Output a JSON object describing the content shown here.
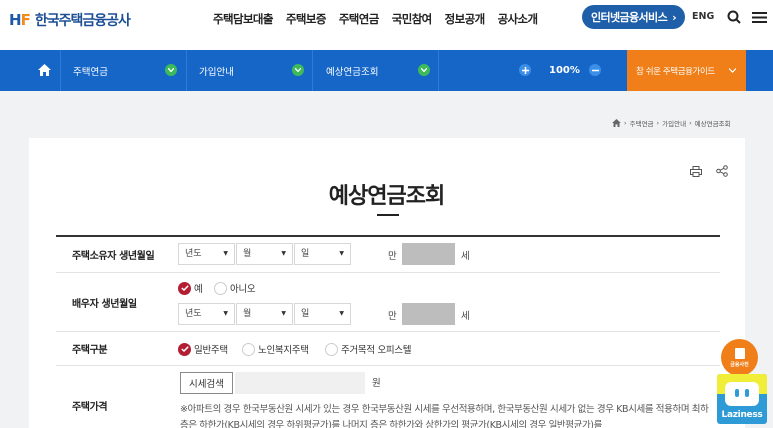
{
  "header": {
    "logo_mark_1": "H",
    "logo_mark_2": "F",
    "logo_text": "한국주택금융공사",
    "gnb": [
      "주택담보대출",
      "주택보증",
      "주택연금",
      "국민참여",
      "정보공개",
      "공사소개"
    ],
    "service_button": "인터넷금융서비스",
    "service_arrow": "›",
    "lang": "ENG"
  },
  "navbar": {
    "level1": "주택연금",
    "level2": "가입안내",
    "level3": "예상연금조회",
    "zoom": "100%",
    "guide": "참 쉬운 주택금융가이드"
  },
  "breadcrumb": [
    "주택연금",
    "가입안내",
    "예상연금조회"
  ],
  "page": {
    "title": "예상연금조회"
  },
  "form": {
    "owner_birth": {
      "label": "주택소유자 생년월일",
      "year": "년도",
      "month": "월",
      "day": "일",
      "age_prefix": "만",
      "age_suffix": "세"
    },
    "spouse_birth": {
      "label": "배우자 생년월일",
      "option_yes": "예",
      "option_no": "아니오",
      "selected": "예",
      "year": "년도",
      "month": "월",
      "day": "일",
      "age_prefix": "만",
      "age_suffix": "세"
    },
    "house_type": {
      "label": "주택구분",
      "options": [
        "일반주택",
        "노인복지주택",
        "주거목적 오피스텔"
      ],
      "selected": "일반주택"
    },
    "house_price": {
      "label": "주택가격",
      "search_button": "시세검색",
      "unit": "원",
      "note": "※아파트의 경우 한국부동산원 시세가 있는 경우 한국부동산원 시세를 우선적용하며, 한국부동산원 시세가 없는 경우 KB시세를 적용하며 최하층은 하한가(KB시세의 경우 하위평균가)를 나머지 층은 하한가와 상한가의 평균가(KB시세의 경우 일반평균가)를"
    }
  },
  "widgets": {
    "dictionary": "금융사전",
    "laziness": "Laziness"
  },
  "colors": {
    "brand_blue": "#1666c8",
    "accent_orange": "#f07f1a",
    "radio_selected": "#b41e32"
  }
}
